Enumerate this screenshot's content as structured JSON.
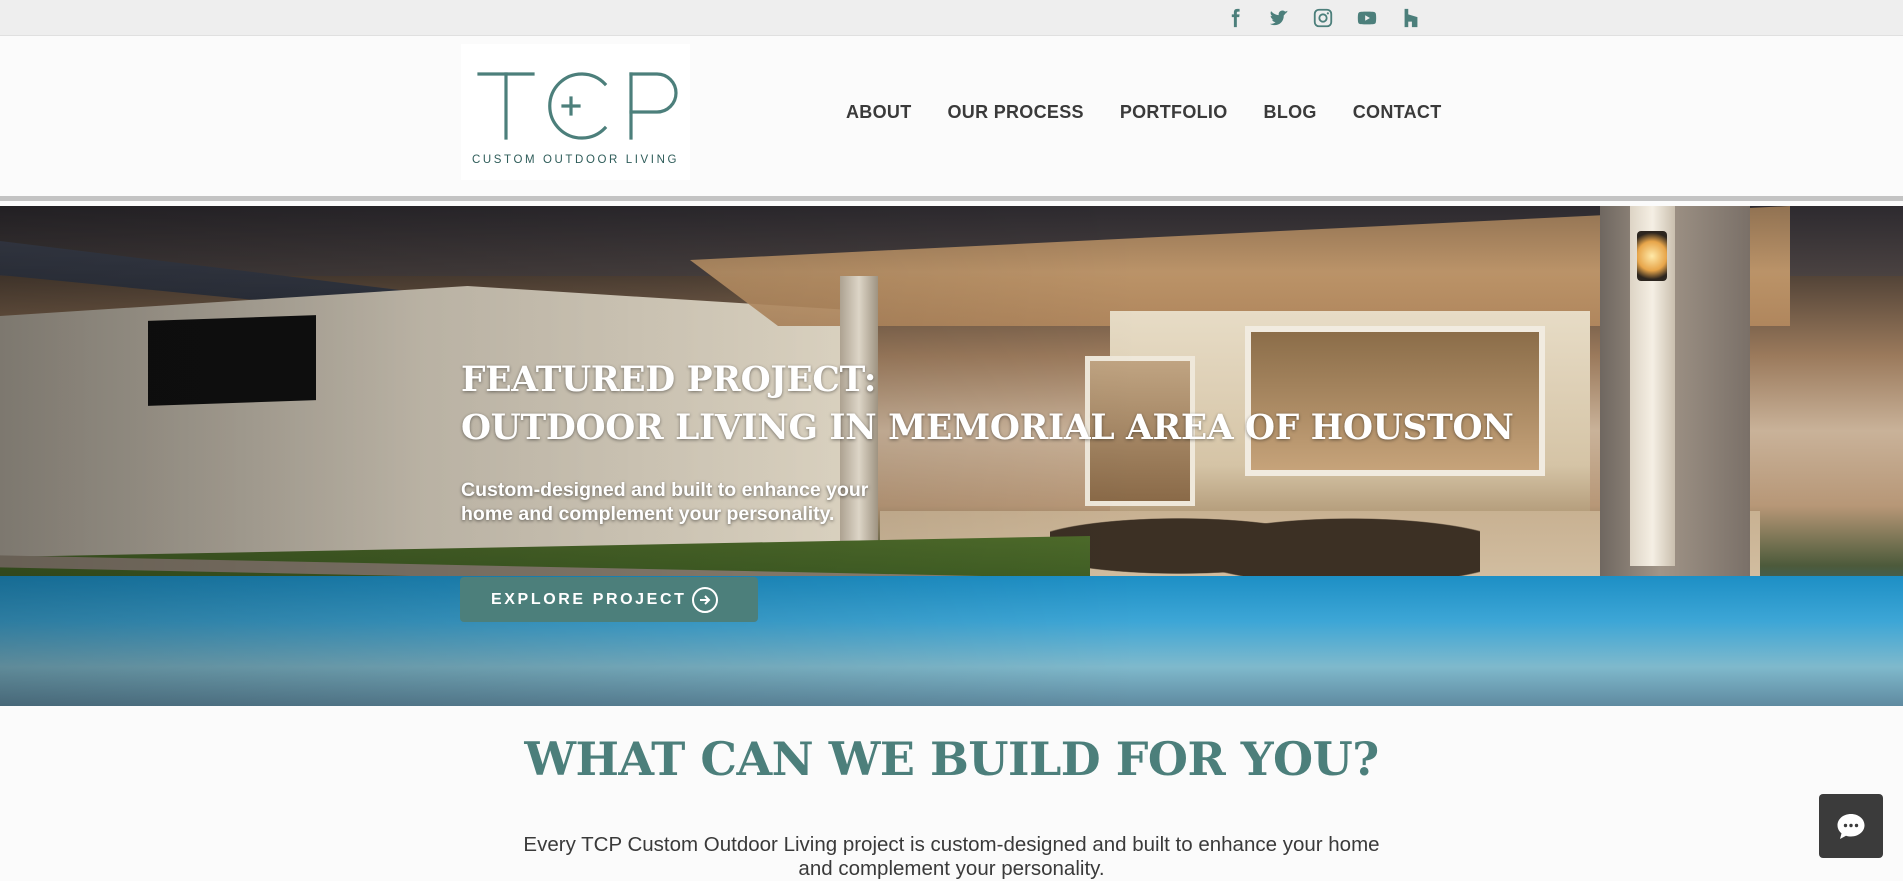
{
  "social": {
    "items": [
      {
        "name": "facebook",
        "icon": "facebook-icon"
      },
      {
        "name": "twitter",
        "icon": "twitter-icon"
      },
      {
        "name": "instagram",
        "icon": "instagram-icon"
      },
      {
        "name": "youtube",
        "icon": "youtube-icon"
      },
      {
        "name": "houzz",
        "icon": "houzz-icon"
      }
    ],
    "color": "#4c7f7b"
  },
  "logo": {
    "mark": "TCP",
    "tagline": "CUSTOM OUTDOOR LIVING",
    "color": "#4c7f7b"
  },
  "nav": {
    "items": [
      "ABOUT",
      "OUR PROCESS",
      "PORTFOLIO",
      "BLOG",
      "CONTACT"
    ]
  },
  "hero": {
    "title_line1": "FEATURED PROJECT:",
    "title_line2": "OUTDOOR LIVING IN MEMORIAL AREA OF HOUSTON",
    "subtitle": "Custom-designed and built to enhance your home and complement your personality.",
    "cta_label": "EXPLORE PROJECT",
    "cta_color": "#4c7f7b"
  },
  "section": {
    "title": "WHAT CAN WE BUILD FOR YOU?",
    "body": "Every TCP Custom Outdoor Living project is custom-designed and built to enhance your home and complement your personality."
  },
  "chat": {
    "icon": "chat-bubble-icon"
  }
}
